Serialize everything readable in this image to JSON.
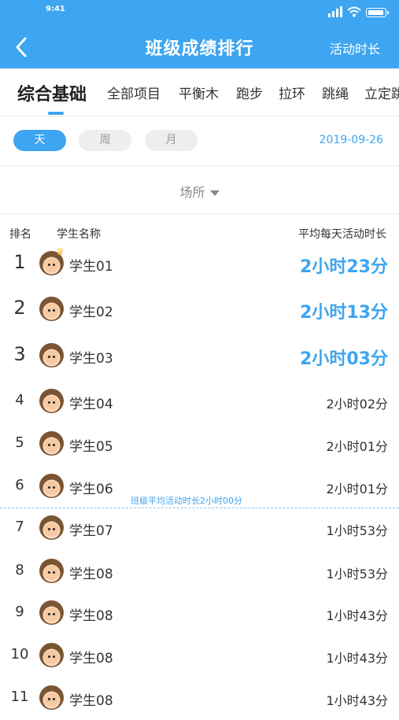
{
  "status_bar": {
    "time": "9:41"
  },
  "header": {
    "title": "班级成绩排行",
    "action": "活动时长"
  },
  "tabs": [
    "综合基础",
    "全部项目",
    "平衡木",
    "跑步",
    "拉环",
    "跳绳",
    "立定跳"
  ],
  "period": {
    "options": [
      "天",
      "周",
      "月"
    ],
    "selected": "天",
    "date": "2019-09-26"
  },
  "filter": {
    "place": "场所"
  },
  "columns": {
    "rank": "排名",
    "name": "学生名称",
    "time": "平均每天活动时长"
  },
  "average_text": "班级平均活动时长2小时00分",
  "students": [
    {
      "rank": "1",
      "name": "学生01",
      "time": "2小时23分"
    },
    {
      "rank": "2",
      "name": "学生02",
      "time": "2小时13分"
    },
    {
      "rank": "3",
      "name": "学生03",
      "time": "2小时03分"
    },
    {
      "rank": "4",
      "name": "学生04",
      "time": "2小时02分"
    },
    {
      "rank": "5",
      "name": "学生05",
      "time": "2小时01分"
    },
    {
      "rank": "6",
      "name": "学生06",
      "time": "2小时01分"
    },
    {
      "rank": "7",
      "name": "学生07",
      "time": "1小时53分"
    },
    {
      "rank": "8",
      "name": "学生08",
      "time": "1小时53分"
    },
    {
      "rank": "9",
      "name": "学生08",
      "time": "1小时43分"
    },
    {
      "rank": "10",
      "name": "学生08",
      "time": "1小时43分"
    },
    {
      "rank": "11",
      "name": "学生08",
      "time": "1小时43分"
    }
  ],
  "colors": {
    "accent": "#3DA5F1",
    "pill_inactive": "#EEEEEE",
    "crown": "#F6C240"
  }
}
